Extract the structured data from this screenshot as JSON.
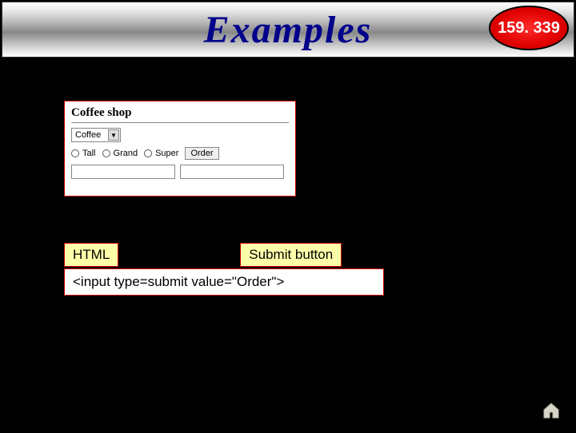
{
  "header": {
    "title": "Examples",
    "badge": "159. 339"
  },
  "form": {
    "heading": "Coffee shop",
    "select_value": "Coffee",
    "radios": {
      "opt1": "Tall",
      "opt2": "Grand",
      "opt3": "Super"
    },
    "order_button": "Order",
    "input1": "",
    "input2": ""
  },
  "labels": {
    "left": "HTML",
    "right": "Submit button"
  },
  "code_line": "<input type=submit  value=\"Order\">",
  "icons": {
    "home": "home-icon"
  }
}
